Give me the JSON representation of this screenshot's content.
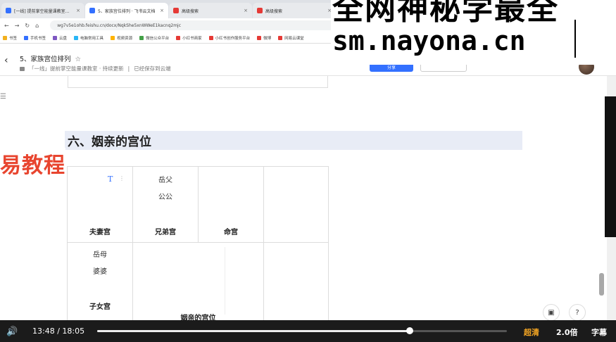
{
  "browser": {
    "tabs": [
      {
        "label": "[一线] 提前掌空能量课教室…",
        "color": "#3370ff",
        "active": false
      },
      {
        "label": "5、家族宫位排列 · 飞书云文档",
        "color": "#3370ff",
        "active": true
      },
      {
        "label": "高级搜索",
        "color": "#e53935",
        "active": false
      },
      {
        "label": "高级搜索",
        "color": "#e53935",
        "active": false
      }
    ],
    "new_tab": "+",
    "url": "wg7v5e1ohb.feishu.cn/docx/NqkShe5xnWWeE1kacnq2mjc",
    "bookmarks": [
      {
        "label": "书签",
        "color": "#f2b01e"
      },
      {
        "label": "手机书签",
        "color": "#3370ff"
      },
      {
        "label": "云盘",
        "color": "#7e57c2"
      },
      {
        "label": "电脑常用工具",
        "color": "#29b6f6"
      },
      {
        "label": "视频资源",
        "color": "#ffb300"
      },
      {
        "label": "微信公众平台",
        "color": "#43a047"
      },
      {
        "label": "小红书商家",
        "color": "#e53935"
      },
      {
        "label": "小红书创作服务平台",
        "color": "#e53935"
      },
      {
        "label": "微博",
        "color": "#e53935"
      },
      {
        "label": "网易云课堂",
        "color": "#e53935"
      }
    ]
  },
  "doc": {
    "title": "5、家族宫位排列",
    "breadcrumb": "「一线」提前掌空能量课教室 · 持续更新",
    "save_status": "已经保存到云端",
    "share_label": "分享",
    "section_heading": "六、姻亲的宫位",
    "grid": {
      "r1c1_label": "夫妻宫",
      "r1c2_line1": "岳父",
      "r1c2_line2": "公公",
      "r1c2_label": "兄弟宫",
      "r1c3_label": "命宫",
      "r2c1_line1": "岳母",
      "r2c1_line2": "婆婆",
      "r2c1_label": "子女宫",
      "center_label": "姻亲的宫位"
    }
  },
  "overlay": {
    "watermark_line1": "全网神秘学最全",
    "watermark_line2": "sm.nayona.cn",
    "banner": "易教程"
  },
  "player": {
    "current_time": "13:48",
    "separator": "/",
    "duration": "18:05",
    "progress": 0.763,
    "quality": "超清",
    "speed": "2.0倍",
    "subtitles": "字幕"
  }
}
